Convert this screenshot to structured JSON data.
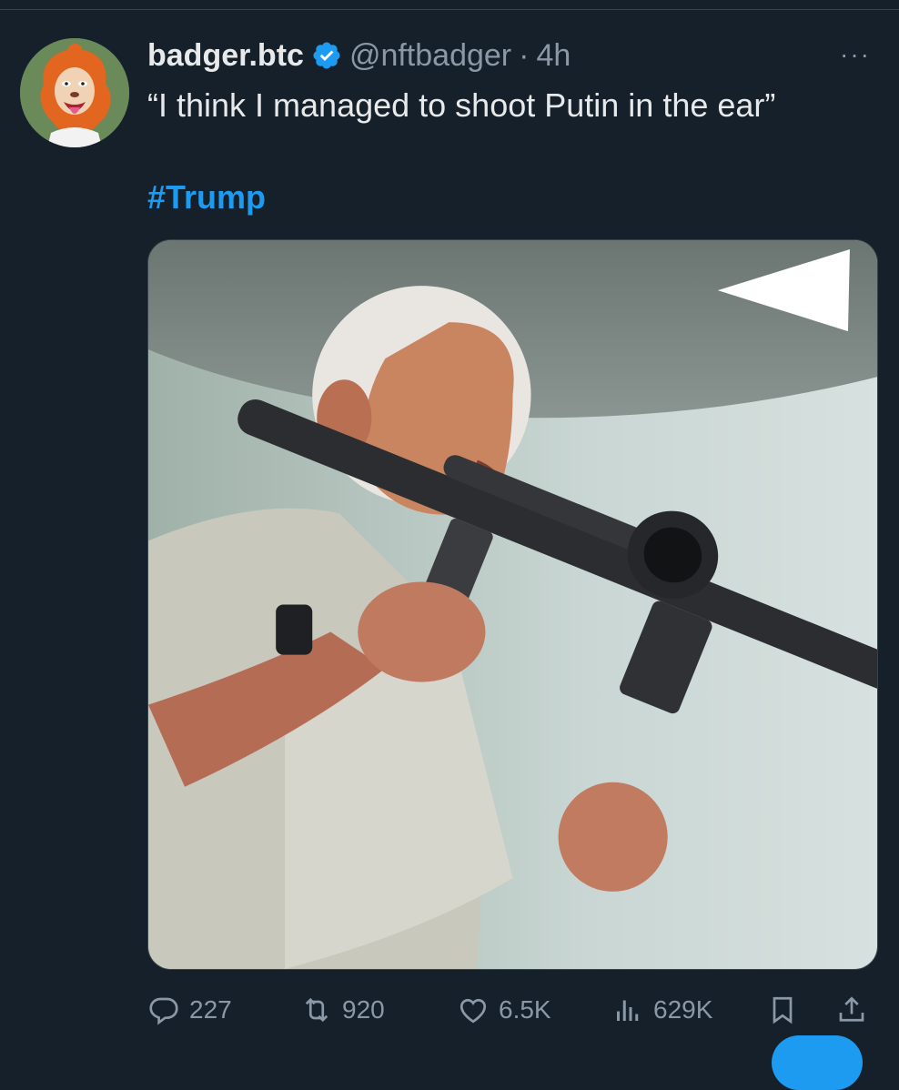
{
  "tweet": {
    "display_name": "badger.btc",
    "handle": "@nftbadger",
    "separator": "·",
    "time": "4h",
    "text": "“I think I managed to shoot Putin in the ear”",
    "hashtag": "#Trump",
    "more_label": "···"
  },
  "actions": {
    "replies": "227",
    "reposts": "920",
    "likes": "6.5K",
    "views": "629K"
  },
  "colors": {
    "background": "#15202b",
    "accent": "#1d9bf0",
    "muted": "#8b98a5",
    "text": "#e7e9ea"
  },
  "icons": [
    "verified-badge-icon",
    "more-icon",
    "reply-icon",
    "repost-icon",
    "like-icon",
    "views-icon",
    "bookmark-icon",
    "share-icon"
  ]
}
